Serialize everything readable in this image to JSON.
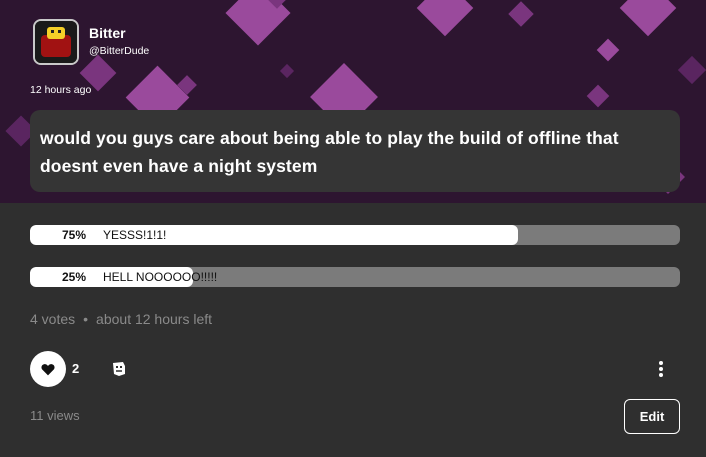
{
  "post": {
    "author_name": "Bitter",
    "author_handle": "@BitterDude",
    "timestamp": "12 hours ago",
    "question": "would you guys care about being able to play the build of offline that doesnt even have a night system"
  },
  "poll": {
    "options": [
      {
        "percent_label": "75%",
        "label": "YESSS!1!1!",
        "fraction": 0.75
      },
      {
        "percent_label": "25%",
        "label": "HELL NOOOOOO!!!!!",
        "fraction": 0.25
      }
    ],
    "votes": "4 votes",
    "separator": "•",
    "time_left": "about 12 hours left"
  },
  "actions": {
    "like_count": "2",
    "views": "11 views",
    "edit_label": "Edit"
  },
  "icons": {
    "like": "heart-icon",
    "reaction": "emoji-reaction-icon",
    "more": "more-vertical-icon"
  },
  "colors": {
    "background": "#2f2f2f",
    "banner_purple": "#9a4a9c",
    "poll_fill": "#ffffff",
    "poll_track": "#7b7b7b"
  }
}
